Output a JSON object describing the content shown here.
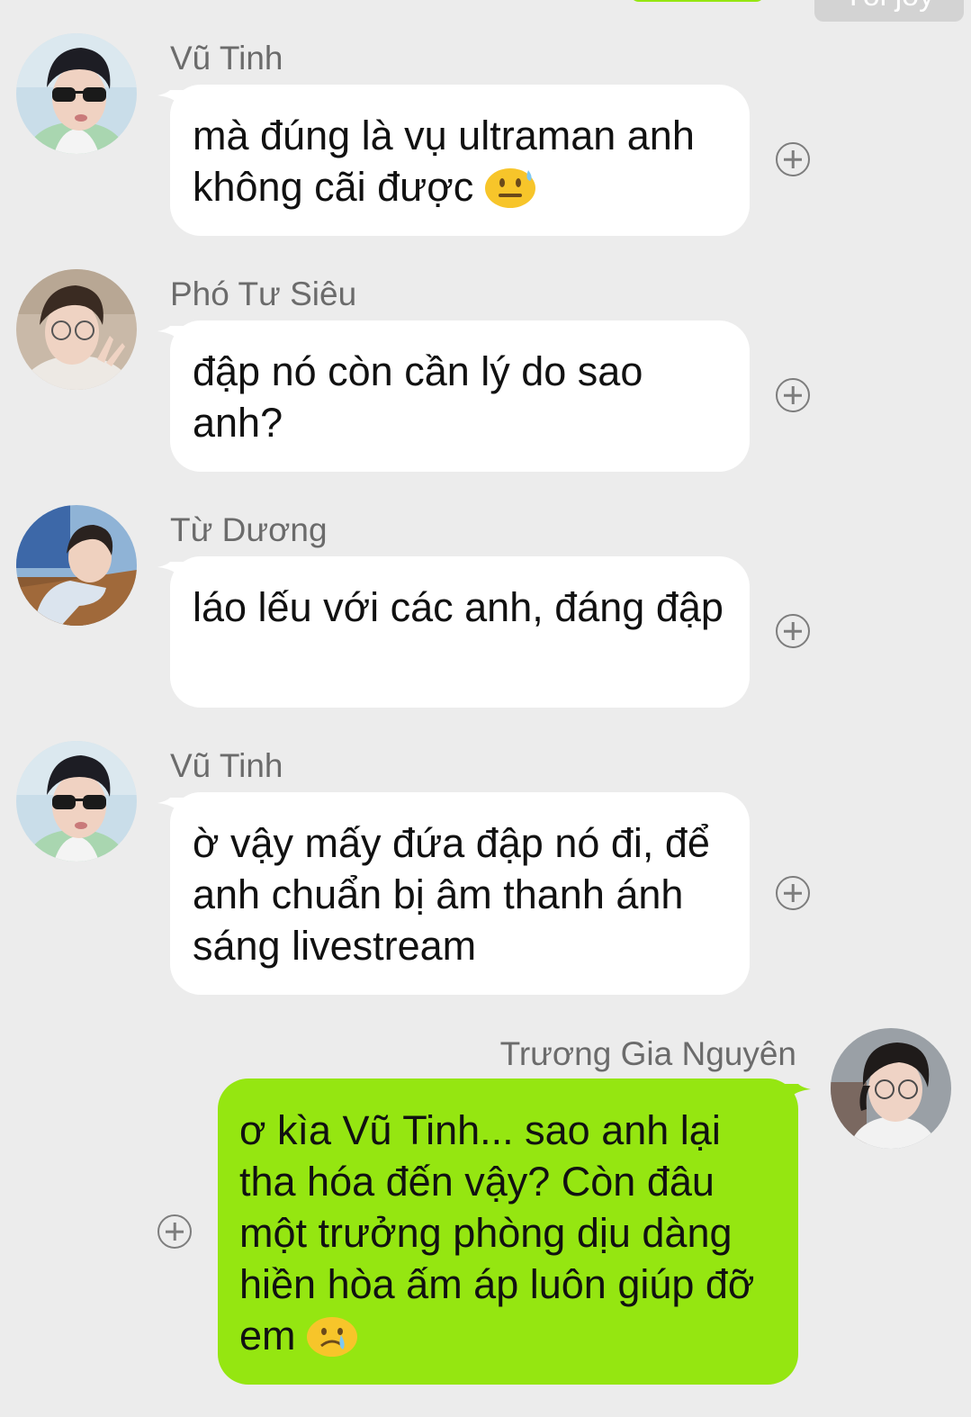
{
  "top_partial": {
    "time_label": "Tôi joy"
  },
  "messages": [
    {
      "sender": "Vũ Tinh",
      "text": "mà đúng là vụ ultraman anh không cãi được",
      "emoji": "sweat-smile-face"
    },
    {
      "sender": "Phó Tư Siêu",
      "text": "đập nó còn cần lý do sao anh?"
    },
    {
      "sender": "Từ Dương",
      "text": "láo lếu với các anh, đáng đập"
    },
    {
      "sender": "Vũ Tinh",
      "text": "ờ vậy mấy đứa đập nó đi, để anh chuẩn bị âm thanh ánh sáng livestream"
    },
    {
      "sender": "Trương Gia Nguyên",
      "text": "ơ kìa Vũ Tinh... sao anh lại tha hóa đến vậy? Còn đâu một trưởng phòng dịu dàng hiền hòa ấm áp luôn giúp đỡ em",
      "emoji": "crying-face",
      "outgoing": true
    }
  ],
  "colors": {
    "background": "#ececec",
    "incoming_bubble": "#ffffff",
    "outgoing_bubble": "#95e611",
    "sender_name": "#6b6b6b"
  },
  "icons": {
    "add_reaction": "plus-circle-icon"
  }
}
